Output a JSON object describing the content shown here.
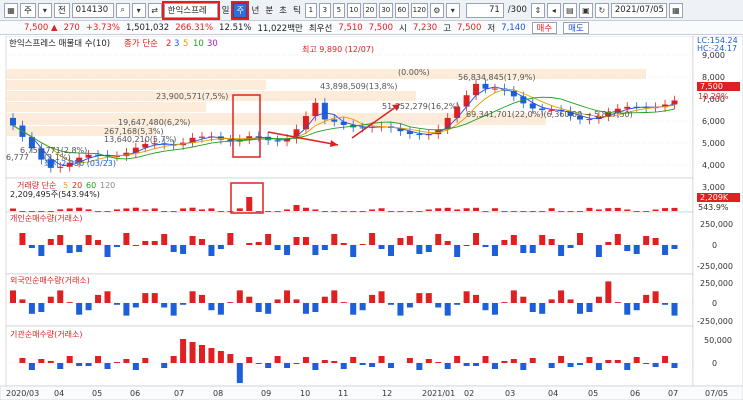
{
  "toolbar": {
    "market": "주",
    "filter": "전",
    "code": "014130",
    "name": "한익스프레",
    "units": [
      "일",
      "주",
      "년",
      "분",
      "초",
      "틱"
    ],
    "periods": [
      "1",
      "3",
      "5",
      "10",
      "20",
      "30",
      "60",
      "120"
    ],
    "count": "71",
    "total": "/300",
    "date": "2021/07/05"
  },
  "quote": {
    "price": "7,500",
    "arrow": "▲",
    "change": "270",
    "pct": "+3.73%",
    "volume": "1,501,032",
    "vol_pct": "266.31%",
    "turnover": "12.51%",
    "amount": "11,022백만",
    "best_label": "최우선",
    "best_ask": "7,510",
    "best_bid": "7,500",
    "open_label": "시",
    "open": "7,230",
    "high_label": "고",
    "high": "7,500",
    "low_label": "저",
    "low": "7,140",
    "buy_label": "매수",
    "sell_label": "매도"
  },
  "colors": {
    "up": "#e02020",
    "down": "#1c5fd8",
    "accent": "#2f6fd6"
  },
  "price_panel": {
    "title": "한익스프레스 매물대 수(10)",
    "ma_label": "종가 단순",
    "ma_periods": [
      "2",
      "3",
      "5",
      "10",
      "30"
    ],
    "ma_colors": [
      "#e02020",
      "#2050e0",
      "#e0a000",
      "#20a020",
      "#a020c0"
    ],
    "lc": "LC:154.24",
    "hc": "HC:-24.17",
    "y_ticks": [
      "9,000",
      "8,000",
      "7,000",
      "6,000",
      "5,000",
      "4,000",
      "3,000"
    ],
    "current_price_tag": "7,500",
    "current_pct_tag": "10.29%",
    "annotations": [
      "최고 9,890 (12/07)",
      "56,834,845(17,9%)",
      "43,898,509(13,8%)",
      "23,900,571(7,5%)",
      "19,647,480(6,2%)",
      "51,352,279(16,2%)",
      "69,341,701(22,0%)(6,360,00 → 5,837,50)",
      "최저 2,950 (03/23)",
      "(0.00%)",
      "6,752,771(2,8%)",
      "6,777",
      "(2,1%)",
      "267,168(5,3%)",
      "13,640,210(5,7%)"
    ]
  },
  "volume_panel": {
    "title": "거래량 단순",
    "ma_periods": [
      "5",
      "20",
      "60",
      "120"
    ],
    "value_text": "2,209,495주(543.94%)",
    "tag1": "2,209K",
    "tag2": "543.9%"
  },
  "individual_panel": {
    "title": "개인순매수량(거래소)",
    "ticks": [
      "250,000",
      "0",
      "-250,000"
    ]
  },
  "foreign_panel": {
    "title": "외국인순매수량(거래소)",
    "ticks": [
      "250,000",
      "0",
      "-250,000"
    ]
  },
  "institution_panel": {
    "title": "기관순매수량(거래소)",
    "ticks": [
      "50,000",
      "0"
    ]
  },
  "x_axis": [
    "2020/03",
    "04",
    "05",
    "06",
    "07",
    "08",
    "09",
    "10",
    "11",
    "12",
    "2021/01",
    "02",
    "03",
    "04",
    "05",
    "06",
    "07"
  ],
  "x_axis_right": "07/05"
}
